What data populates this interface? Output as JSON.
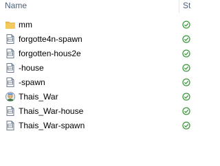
{
  "header": {
    "name_label": "Name",
    "status_label": "St"
  },
  "colors": {
    "header_text": "#4c607a",
    "folder_yellow": "#f4c95d",
    "sync_green": "#3b9a3b"
  },
  "files": [
    {
      "name": "mm",
      "icon": "folder-icon"
    },
    {
      "name": "forgotte4n-spawn",
      "icon": "file-icon"
    },
    {
      "name": "forgotten-hous2e",
      "icon": "file-icon"
    },
    {
      "name": "-house",
      "icon": "file-icon"
    },
    {
      "name": "-spawn",
      "icon": "file-icon"
    },
    {
      "name": "Thais_War",
      "icon": "map-app-icon"
    },
    {
      "name": "Thais_War-house",
      "icon": "file-icon"
    },
    {
      "name": "Thais_War-spawn",
      "icon": "file-icon"
    }
  ]
}
